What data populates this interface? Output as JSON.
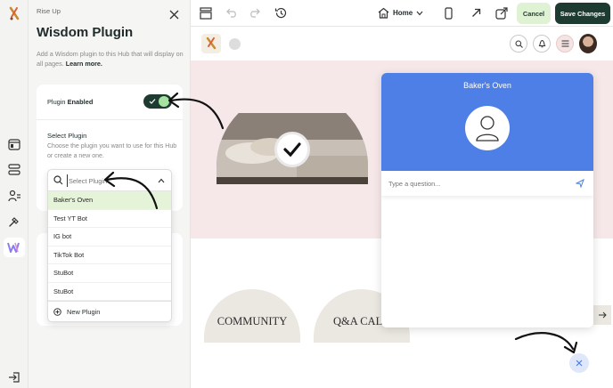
{
  "rail": {
    "items": [
      {
        "icon": "chef-logo-icon"
      },
      {
        "icon": "pages-icon"
      },
      {
        "icon": "content-list-icon"
      },
      {
        "icon": "members-icon"
      },
      {
        "icon": "tools-icon"
      },
      {
        "icon": "wisdom-plugin-icon"
      },
      {
        "icon": "logout-icon"
      }
    ]
  },
  "panel": {
    "breadcrumb": "Rise Up",
    "title": "Wisdom Plugin",
    "description_prefix": "Add a Wisdom plugin to this Hub that will display on all pages.",
    "description_link": "Learn more.",
    "plugin_label_prefix": "Plugin",
    "plugin_label_bold": "Enabled",
    "select_label": "Select Plugin",
    "select_help": "Choose the plugin you want to use for this Hub or create a new one.",
    "search_placeholder": "Select Plugin",
    "options": [
      "Baker's Oven",
      "Test YT Bot",
      "IG bot",
      "TikTok Bot",
      "StuBot",
      "StuBot"
    ],
    "selected_option": "Baker's Oven",
    "new_plugin_label": "New Plugin"
  },
  "toolbar": {
    "page_selector": "Home",
    "cancel_label": "Cancel",
    "save_label": "Save Changes"
  },
  "preview": {
    "chat_title": "Baker's Oven",
    "chat_placeholder": "Type a question...",
    "cards": [
      "COMMUNITY",
      "Q&A CALL"
    ]
  },
  "colors": {
    "accent_green": "#1e3b32",
    "toggle_knob": "#a7e2a2",
    "cancel_bg": "#dff2d4",
    "chat_header": "#4e7fe6",
    "hero_bg": "#f6e8e8",
    "selected_row": "#e5f3d9"
  }
}
